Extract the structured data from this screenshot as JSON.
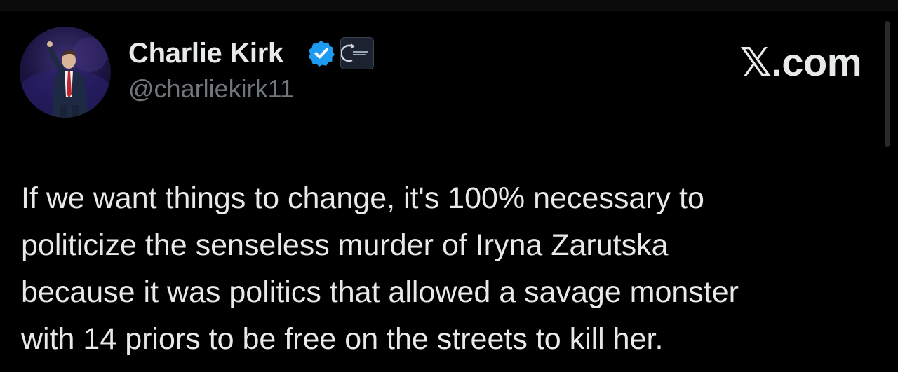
{
  "tweet": {
    "author": {
      "display_name": "Charlie Kirk",
      "handle": "@charliekirk11",
      "verified_icon": "verified-badge-icon",
      "affiliate_badge": "turning-point-logo"
    },
    "brand": "𝕏.com",
    "text_lines": [
      "If we want things to change, it's 100% necessary to",
      "politicize the senseless murder of Iryna Zarutska",
      "because it was politics that allowed a savage monster",
      "with 14 priors to be free on the streets to kill her."
    ]
  },
  "colors": {
    "background": "#000000",
    "text_primary": "#e7e9ea",
    "text_secondary": "#71767b",
    "verified_blue": "#1d9bf0"
  }
}
